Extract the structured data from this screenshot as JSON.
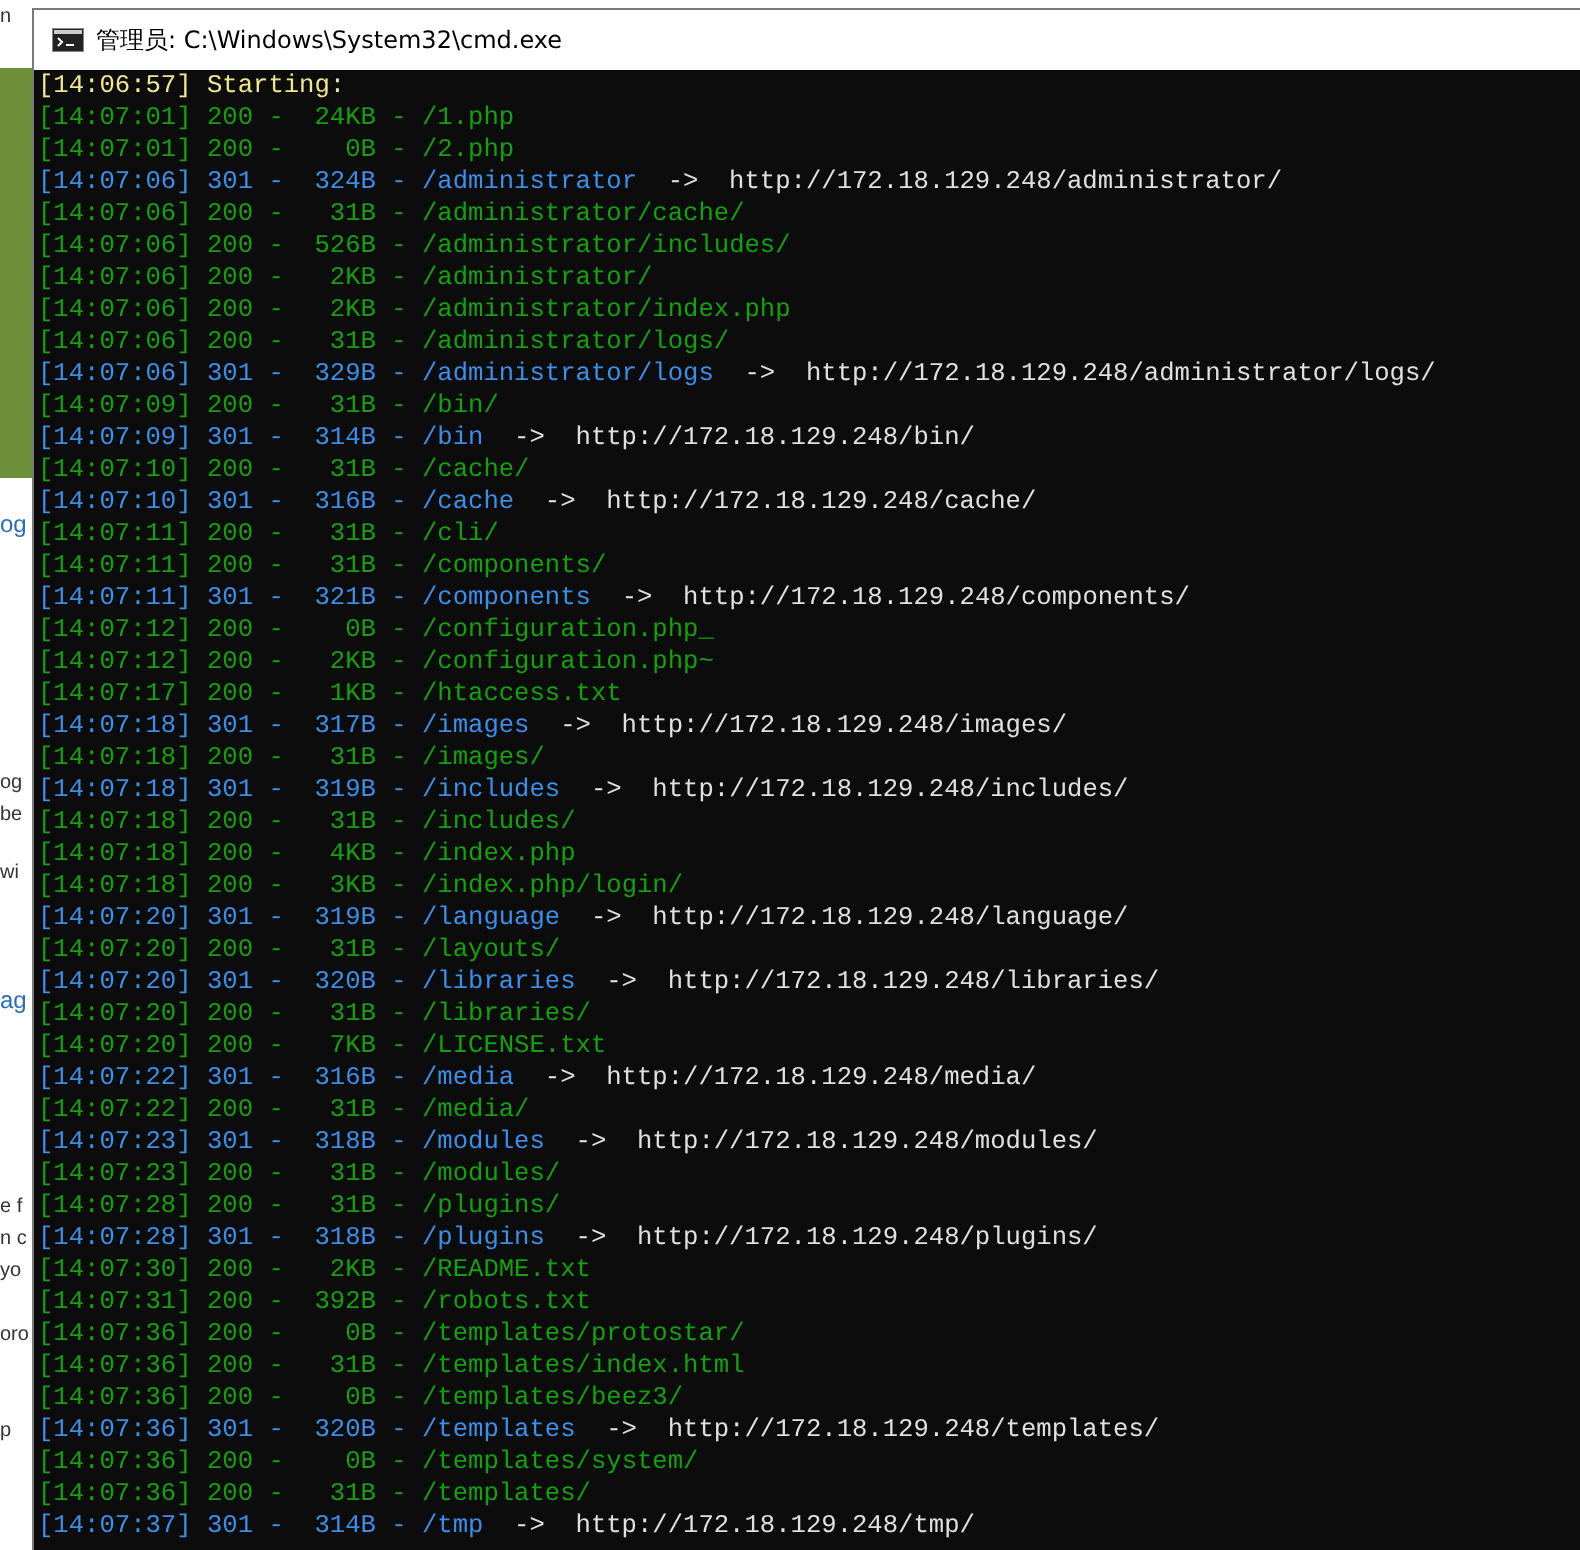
{
  "background": {
    "fragments": [
      {
        "text": "n",
        "kind": "small"
      },
      {
        "text": "og",
        "kind": "heading"
      },
      {
        "text": "og",
        "kind": "small"
      },
      {
        "text": "be",
        "kind": "small"
      },
      {
        "text": "wi",
        "kind": "small"
      },
      {
        "text": "ag",
        "kind": "heading"
      },
      {
        "text": "e f",
        "kind": "small"
      },
      {
        "text": "n c",
        "kind": "small"
      },
      {
        "text": "yo",
        "kind": "small"
      },
      {
        "text": "oro",
        "kind": "small"
      },
      {
        "text": "p",
        "kind": "small"
      }
    ]
  },
  "window": {
    "title": "管理员: C:\\Windows\\System32\\cmd.exe"
  },
  "console": {
    "lines": [
      {
        "kind": "info",
        "text": "[14:06:57] Starting:"
      },
      {
        "kind": "ok",
        "text": "[14:07:01] 200 -  24KB - /1.php"
      },
      {
        "kind": "ok",
        "text": "[14:07:01] 200 -    0B - /2.php"
      },
      {
        "kind": "redirect",
        "text": "[14:07:06] 301 -  324B - /administrator",
        "redirect": "->  http://172.18.129.248/administrator/"
      },
      {
        "kind": "ok",
        "text": "[14:07:06] 200 -   31B - /administrator/cache/"
      },
      {
        "kind": "ok",
        "text": "[14:07:06] 200 -  526B - /administrator/includes/"
      },
      {
        "kind": "ok",
        "text": "[14:07:06] 200 -   2KB - /administrator/"
      },
      {
        "kind": "ok",
        "text": "[14:07:06] 200 -   2KB - /administrator/index.php"
      },
      {
        "kind": "ok",
        "text": "[14:07:06] 200 -   31B - /administrator/logs/"
      },
      {
        "kind": "redirect",
        "text": "[14:07:06] 301 -  329B - /administrator/logs",
        "redirect": "->  http://172.18.129.248/administrator/logs/"
      },
      {
        "kind": "ok",
        "text": "[14:07:09] 200 -   31B - /bin/"
      },
      {
        "kind": "redirect",
        "text": "[14:07:09] 301 -  314B - /bin",
        "redirect": "->  http://172.18.129.248/bin/"
      },
      {
        "kind": "ok",
        "text": "[14:07:10] 200 -   31B - /cache/"
      },
      {
        "kind": "redirect",
        "text": "[14:07:10] 301 -  316B - /cache",
        "redirect": "->  http://172.18.129.248/cache/"
      },
      {
        "kind": "ok",
        "text": "[14:07:11] 200 -   31B - /cli/"
      },
      {
        "kind": "ok",
        "text": "[14:07:11] 200 -   31B - /components/"
      },
      {
        "kind": "redirect",
        "text": "[14:07:11] 301 -  321B - /components",
        "redirect": "->  http://172.18.129.248/components/"
      },
      {
        "kind": "ok",
        "text": "[14:07:12] 200 -    0B - /configuration.php_"
      },
      {
        "kind": "ok",
        "text": "[14:07:12] 200 -   2KB - /configuration.php~"
      },
      {
        "kind": "ok",
        "text": "[14:07:17] 200 -   1KB - /htaccess.txt"
      },
      {
        "kind": "redirect",
        "text": "[14:07:18] 301 -  317B - /images",
        "redirect": "->  http://172.18.129.248/images/"
      },
      {
        "kind": "ok",
        "text": "[14:07:18] 200 -   31B - /images/"
      },
      {
        "kind": "redirect",
        "text": "[14:07:18] 301 -  319B - /includes",
        "redirect": "->  http://172.18.129.248/includes/"
      },
      {
        "kind": "ok",
        "text": "[14:07:18] 200 -   31B - /includes/"
      },
      {
        "kind": "ok",
        "text": "[14:07:18] 200 -   4KB - /index.php"
      },
      {
        "kind": "ok",
        "text": "[14:07:18] 200 -   3KB - /index.php/login/"
      },
      {
        "kind": "redirect",
        "text": "[14:07:20] 301 -  319B - /language",
        "redirect": "->  http://172.18.129.248/language/"
      },
      {
        "kind": "ok",
        "text": "[14:07:20] 200 -   31B - /layouts/"
      },
      {
        "kind": "redirect",
        "text": "[14:07:20] 301 -  320B - /libraries",
        "redirect": "->  http://172.18.129.248/libraries/"
      },
      {
        "kind": "ok",
        "text": "[14:07:20] 200 -   31B - /libraries/"
      },
      {
        "kind": "ok",
        "text": "[14:07:20] 200 -   7KB - /LICENSE.txt"
      },
      {
        "kind": "redirect",
        "text": "[14:07:22] 301 -  316B - /media",
        "redirect": "->  http://172.18.129.248/media/"
      },
      {
        "kind": "ok",
        "text": "[14:07:22] 200 -   31B - /media/"
      },
      {
        "kind": "redirect",
        "text": "[14:07:23] 301 -  318B - /modules",
        "redirect": "->  http://172.18.129.248/modules/"
      },
      {
        "kind": "ok",
        "text": "[14:07:23] 200 -   31B - /modules/"
      },
      {
        "kind": "ok",
        "text": "[14:07:28] 200 -   31B - /plugins/"
      },
      {
        "kind": "redirect",
        "text": "[14:07:28] 301 -  318B - /plugins",
        "redirect": "->  http://172.18.129.248/plugins/"
      },
      {
        "kind": "ok",
        "text": "[14:07:30] 200 -   2KB - /README.txt"
      },
      {
        "kind": "ok",
        "text": "[14:07:31] 200 -  392B - /robots.txt"
      },
      {
        "kind": "ok",
        "text": "[14:07:36] 200 -    0B - /templates/protostar/"
      },
      {
        "kind": "ok",
        "text": "[14:07:36] 200 -   31B - /templates/index.html"
      },
      {
        "kind": "ok",
        "text": "[14:07:36] 200 -    0B - /templates/beez3/"
      },
      {
        "kind": "redirect",
        "text": "[14:07:36] 301 -  320B - /templates",
        "redirect": "->  http://172.18.129.248/templates/"
      },
      {
        "kind": "ok",
        "text": "[14:07:36] 200 -    0B - /templates/system/"
      },
      {
        "kind": "ok",
        "text": "[14:07:36] 200 -   31B - /templates/"
      },
      {
        "kind": "redirect",
        "text": "[14:07:37] 301 -  314B - /tmp",
        "redirect": "->  http://172.18.129.248/tmp/"
      }
    ]
  }
}
